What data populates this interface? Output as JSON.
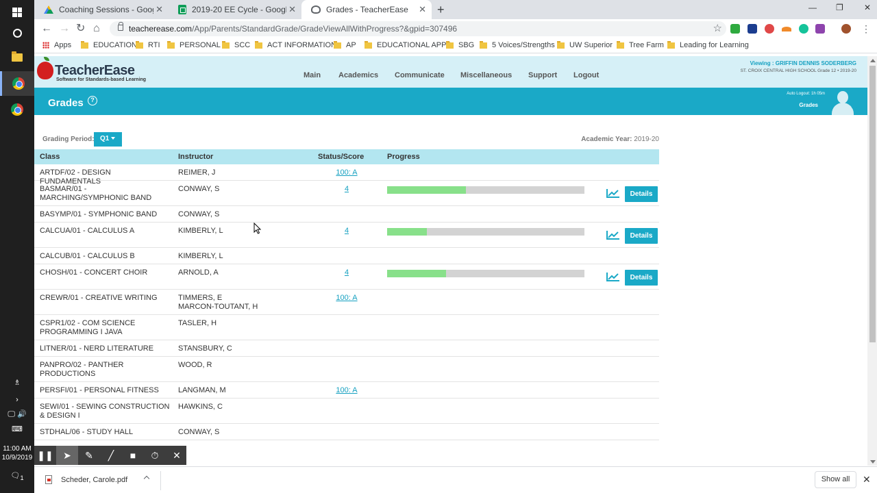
{
  "taskbar": {
    "clock_time": "11:00 AM",
    "clock_date": "10/9/2019",
    "notification_count": "1"
  },
  "browser": {
    "tabs": [
      {
        "title": "Coaching Sessions - Google Driv",
        "favicon": "google-drive-icon"
      },
      {
        "title": "2019-20 EE Cycle - Google Sheet",
        "favicon": "google-sheets-icon"
      },
      {
        "title": "Grades - TeacherEase",
        "favicon": "teacherease-icon"
      }
    ],
    "url_host": "teacherease.com",
    "url_path": "/App/Parents/StandardGrade/GradeViewAllWithProgress?&gpid=307496",
    "bookmarks": [
      "Apps",
      "EDUCATION",
      "RTI",
      "PERSONAL",
      "SCC",
      "ACT INFORMATION",
      "AP",
      "EDUCATIONAL APPS",
      "SBG",
      "5 Voices/Strengths",
      "UW Superior",
      "Tree Farm",
      "Leading for Learning"
    ]
  },
  "site": {
    "logo_word_teacher": "Teacher",
    "logo_word_ease": "Ease",
    "logo_tagline": "Software for Standards-based Learning",
    "nav": [
      "Main",
      "Academics",
      "Communicate",
      "Miscellaneous",
      "Support",
      "Logout"
    ],
    "viewing": "Viewing : GRIFFIN DENNIS SODERBERG",
    "school": "ST. CROIX CENTRAL HIGH SCHOOL Grade 12 • 2019-20",
    "page_title": "Grades",
    "help_glyph": "?",
    "auto_logout": "Auto Logout: 1h 05m",
    "bar_grades": "Grades"
  },
  "filters": {
    "grading_period_label": "Grading Period:",
    "grading_period_value": "Q1",
    "academic_year_label": "Academic Year:",
    "academic_year_value": "2019-20"
  },
  "table": {
    "headers": {
      "class": "Class",
      "instructor": "Instructor",
      "score": "Status/Score",
      "progress": "Progress"
    },
    "details_label": "Details",
    "rows": [
      {
        "class": "ARTDF/02 - DESIGN FUNDAMENTALS",
        "instructor": "REIMER, J",
        "score": "100: A",
        "progress": null
      },
      {
        "class": "BASMAR/01 - MARCHING/SYMPHONIC BAND",
        "instructor": "CONWAY, S",
        "score": "4",
        "progress": 0.4
      },
      {
        "class": "BASYMP/01 - SYMPHONIC BAND",
        "instructor": "CONWAY, S",
        "score": "",
        "progress": null
      },
      {
        "class": "CALCUA/01 - CALCULUS A",
        "instructor": "KIMBERLY, L",
        "score": "4",
        "progress": 0.2
      },
      {
        "class": "CALCUB/01 - CALCULUS B",
        "instructor": "KIMBERLY, L",
        "score": "",
        "progress": null
      },
      {
        "class": "CHOSH/01 - CONCERT CHOIR",
        "instructor": "ARNOLD, A",
        "score": "4",
        "progress": 0.3
      },
      {
        "class": "CREWR/01 - CREATIVE WRITING",
        "instructor": "TIMMERS, E\nMARCON-TOUTANT, H",
        "score": "100: A",
        "progress": null
      },
      {
        "class": "CSPR1/02 - COM SCIENCE PROGRAMMING I JAVA",
        "instructor": "TASLER, H",
        "score": "",
        "progress": null
      },
      {
        "class": "LITNER/01 - NERD LITERATURE",
        "instructor": "STANSBURY, C",
        "score": "",
        "progress": null
      },
      {
        "class": "PANPRO/02 - PANTHER PRODUCTIONS",
        "instructor": "WOOD, R",
        "score": "",
        "progress": null
      },
      {
        "class": "PERSFI/01 - PERSONAL FITNESS",
        "instructor": "LANGMAN, M",
        "score": "100: A",
        "progress": null
      },
      {
        "class": "SEWI/01 - SEWING CONSTRUCTION & DESIGN I",
        "instructor": "HAWKINS, C",
        "score": "",
        "progress": null
      },
      {
        "class": "STDHAL/06 - STUDY HALL",
        "instructor": "CONWAY, S",
        "score": "",
        "progress": null
      }
    ]
  },
  "downloads": {
    "file_name": "Scheder, Carole.pdf",
    "show_all": "Show all"
  },
  "colors": {
    "accent": "#1aa9c7",
    "header_bg": "#d6f0f7",
    "progress_fill": "#88e08a"
  }
}
